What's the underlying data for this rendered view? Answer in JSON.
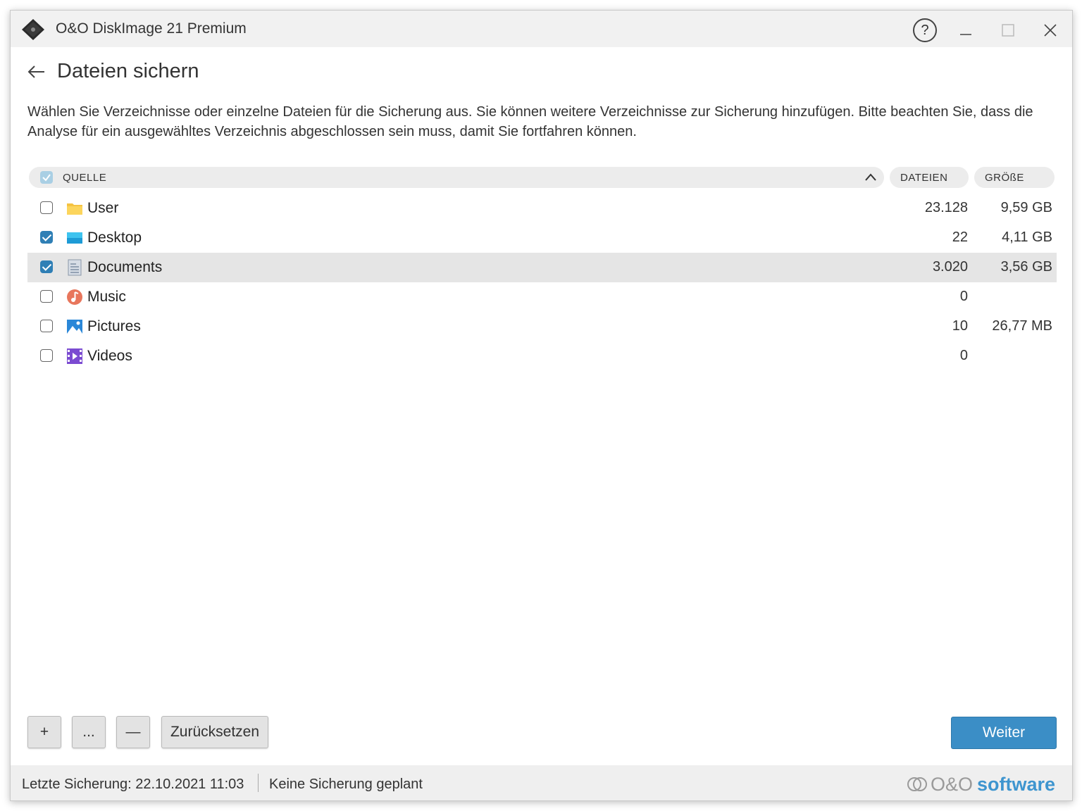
{
  "window": {
    "title": "O&O DiskImage 21 Premium",
    "help_label": "?"
  },
  "header": {
    "title": "Dateien sichern",
    "description": "Wählen Sie Verzeichnisse oder einzelne Dateien für die Sicherung aus. Sie können weitere Verzeichnisse zur Sicherung hinzufügen. Bitte beachten Sie, dass die Analyse für ein ausgewähltes Verzeichnis abgeschlossen sein muss, damit Sie fortfahren können."
  },
  "table": {
    "columns": {
      "source": "QUELLE",
      "files": "DATEIEN",
      "size": "GRÖßE"
    },
    "rows": [
      {
        "name": "User",
        "files": "23.128",
        "size": "9,59 GB",
        "checked": false,
        "icon": "folder-icon"
      },
      {
        "name": "Desktop",
        "files": "22",
        "size": "4,11 GB",
        "checked": true,
        "icon": "desktop-icon"
      },
      {
        "name": "Documents",
        "files": "3.020",
        "size": "3,56 GB",
        "checked": true,
        "icon": "documents-icon"
      },
      {
        "name": "Music",
        "files": "0",
        "size": "",
        "checked": false,
        "icon": "music-icon"
      },
      {
        "name": "Pictures",
        "files": "10",
        "size": "26,77 MB",
        "checked": false,
        "icon": "pictures-icon"
      },
      {
        "name": "Videos",
        "files": "0",
        "size": "",
        "checked": false,
        "icon": "videos-icon"
      }
    ]
  },
  "buttons": {
    "add": "+",
    "more": "...",
    "remove": "—",
    "reset": "Zurücksetzen",
    "next": "Weiter"
  },
  "status": {
    "last_backup": "Letzte Sicherung: 22.10.2021 11:03",
    "schedule": "Keine Sicherung geplant",
    "brand_oo": "O&O",
    "brand_software": "software"
  },
  "colors": {
    "accent": "#3b8ec6",
    "checkbox_checked": "#2f7fb5",
    "selected_row": "#e5e5e5",
    "brand_blue": "#3e95cf"
  }
}
